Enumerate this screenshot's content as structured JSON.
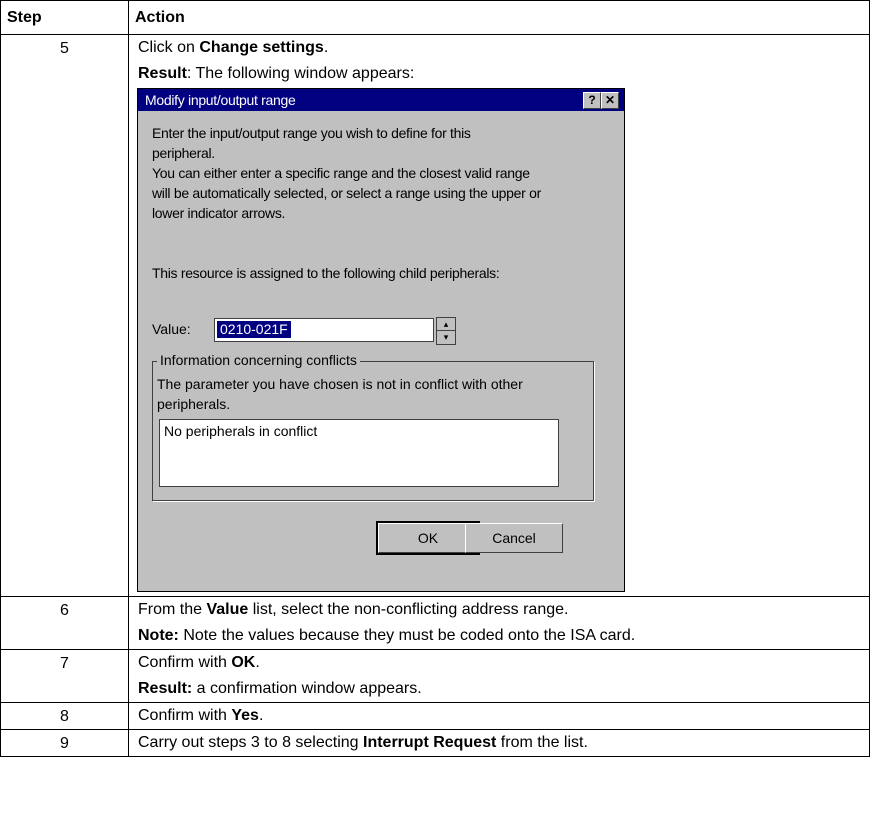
{
  "table": {
    "header": {
      "step": "Step",
      "action": "Action"
    },
    "rows": [
      {
        "step": "5",
        "line1_pre": "Click on ",
        "line1_bold": "Change settings",
        "line1_post": ".",
        "line2_bold": "Result",
        "line2_post": ": The following window appears:"
      },
      {
        "step": "6",
        "line1_pre": "From the ",
        "line1_bold": "Value",
        "line1_post": " list, select the non-conflicting address range.",
        "line2_bold": "Note:",
        "line2_post": " Note the values because they must be coded onto the ISA card."
      },
      {
        "step": "7",
        "line1_pre": "Confirm with ",
        "line1_bold": "OK",
        "line1_post": ".",
        "line2_bold": "Result:",
        "line2_post": " a confirmation window appears."
      },
      {
        "step": "8",
        "line1_pre": "Confirm with ",
        "line1_bold": "Yes",
        "line1_post": "."
      },
      {
        "step": "9",
        "line1_pre": "Carry out steps 3 to 8 selecting ",
        "line1_bold": "Interrupt Request",
        "line1_post": " from the list."
      }
    ]
  },
  "dialog": {
    "title": "Modify input/output range",
    "help_glyph": "?",
    "close_glyph": "✕",
    "text_lines": [
      "Enter the input/output range you wish to define for this",
      "peripheral.",
      "You can either enter a specific range and the closest valid range",
      "will be automatically selected, or select a range using the upper or",
      "lower indicator arrows."
    ],
    "assigned_text": "This resource is assigned to the following child peripherals:",
    "value_label": "Value:",
    "value": "0210-021F",
    "group_title": "Information concerning conflicts",
    "group_text": "The parameter you have chosen is not in conflict with other peripherals.",
    "conflict_item": "No peripherals in conflict",
    "ok_label": "OK",
    "cancel_label": "Cancel"
  }
}
